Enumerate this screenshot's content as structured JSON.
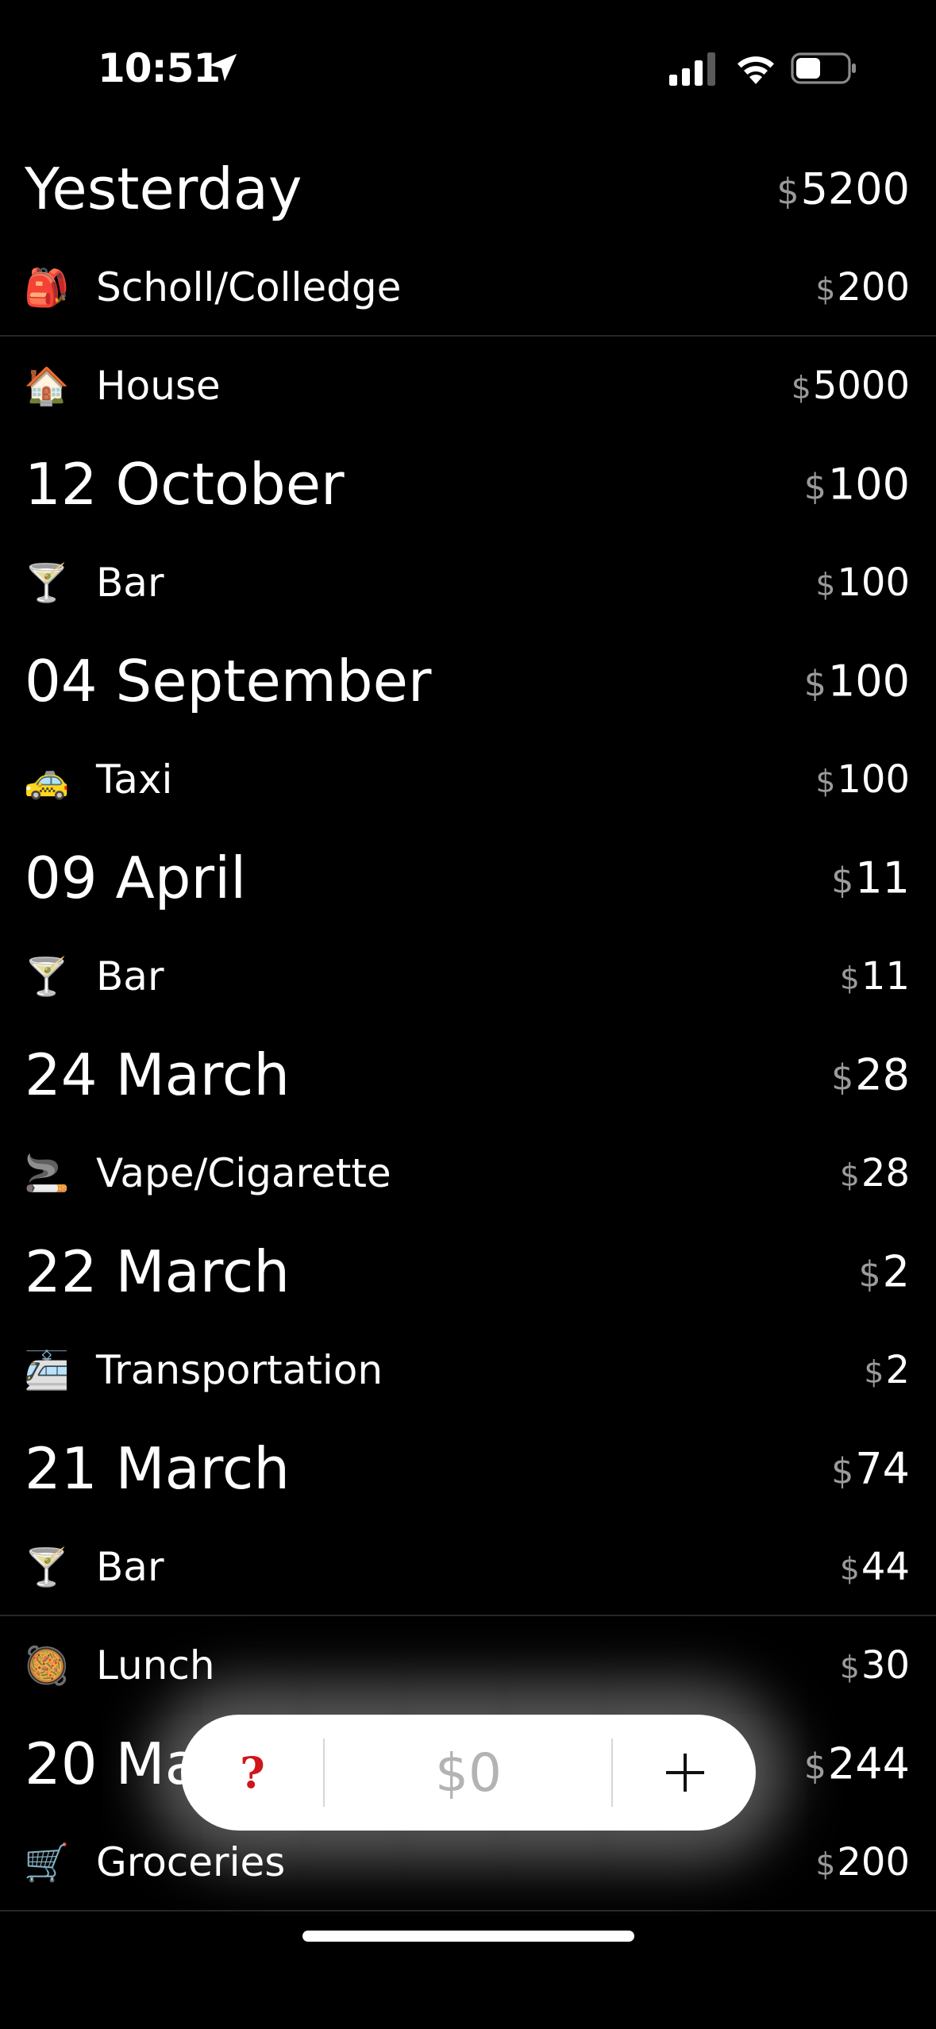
{
  "status_bar": {
    "time": "10:51",
    "icons": [
      "location-arrow-icon",
      "cellular-signal-icon",
      "wifi-icon",
      "battery-icon"
    ]
  },
  "currency_symbol": "$",
  "groups": [
    {
      "date": "Yesterday",
      "total": "5200",
      "items": [
        {
          "emoji": "🎒",
          "icon": "backpack-icon",
          "label": "Scholl/Colledge",
          "amount": "200",
          "divider_after": true
        },
        {
          "emoji": "🏠",
          "icon": "house-icon",
          "label": "House",
          "amount": "5000",
          "divider_after": false
        }
      ]
    },
    {
      "date": "12 October",
      "total": "100",
      "items": [
        {
          "emoji": "🍸",
          "icon": "cocktail-icon",
          "label": "Bar",
          "amount": "100",
          "divider_after": false
        }
      ]
    },
    {
      "date": "04 September",
      "total": "100",
      "items": [
        {
          "emoji": "🚕",
          "icon": "taxi-icon",
          "label": "Taxi",
          "amount": "100",
          "divider_after": false
        }
      ]
    },
    {
      "date": "09 April",
      "total": "11",
      "items": [
        {
          "emoji": "🍸",
          "icon": "cocktail-icon",
          "label": "Bar",
          "amount": "11",
          "divider_after": false
        }
      ]
    },
    {
      "date": "24 March",
      "total": "28",
      "items": [
        {
          "emoji": "🚬",
          "icon": "cigarette-icon",
          "label": "Vape/Cigarette",
          "amount": "28",
          "divider_after": false
        }
      ]
    },
    {
      "date": "22 March",
      "total": "2",
      "items": [
        {
          "emoji": "🚈",
          "icon": "train-icon",
          "label": "Transportation",
          "amount": "2",
          "divider_after": false
        }
      ]
    },
    {
      "date": "21 March",
      "total": "74",
      "items": [
        {
          "emoji": "🍸",
          "icon": "cocktail-icon",
          "label": "Bar",
          "amount": "44",
          "divider_after": true
        },
        {
          "emoji": "🥘",
          "icon": "food-pan-icon",
          "label": "Lunch",
          "amount": "30",
          "divider_after": false
        }
      ]
    },
    {
      "date": "20 Ma",
      "total": "244",
      "items": [
        {
          "emoji": "🛒",
          "icon": "shopping-cart-icon",
          "label": "Groceries",
          "amount": "200",
          "divider_after": true
        }
      ]
    }
  ],
  "quick_entry": {
    "help_label": "?",
    "amount": "$0",
    "add_label": "+"
  },
  "colors": {
    "background": "#000000",
    "currency": "#9a9a9a",
    "help": "#d0151b",
    "amount_placeholder": "#b3b3b3"
  }
}
